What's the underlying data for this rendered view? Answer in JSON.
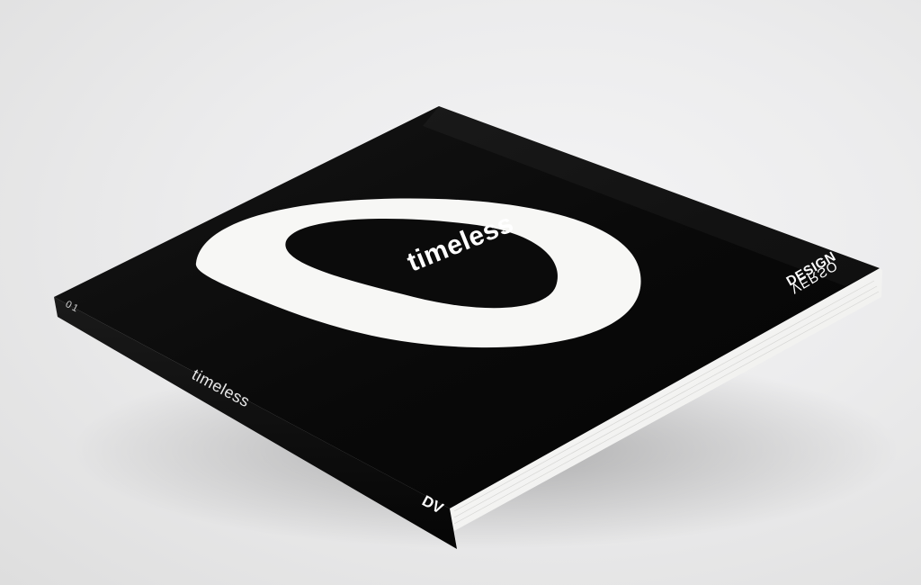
{
  "photo": {
    "subject": "book",
    "background_color": "#ececed",
    "cover_color": "#0b0b0b",
    "shape_color": "#f7f7f5",
    "page_edge_color": "#f1f1ef"
  },
  "cover": {
    "title": "timeless",
    "logo_line1": "DESIGN",
    "logo_line2": "VERSO"
  },
  "spine": {
    "issue_number": "01",
    "title": "timeless",
    "logo_mark": "DV"
  }
}
